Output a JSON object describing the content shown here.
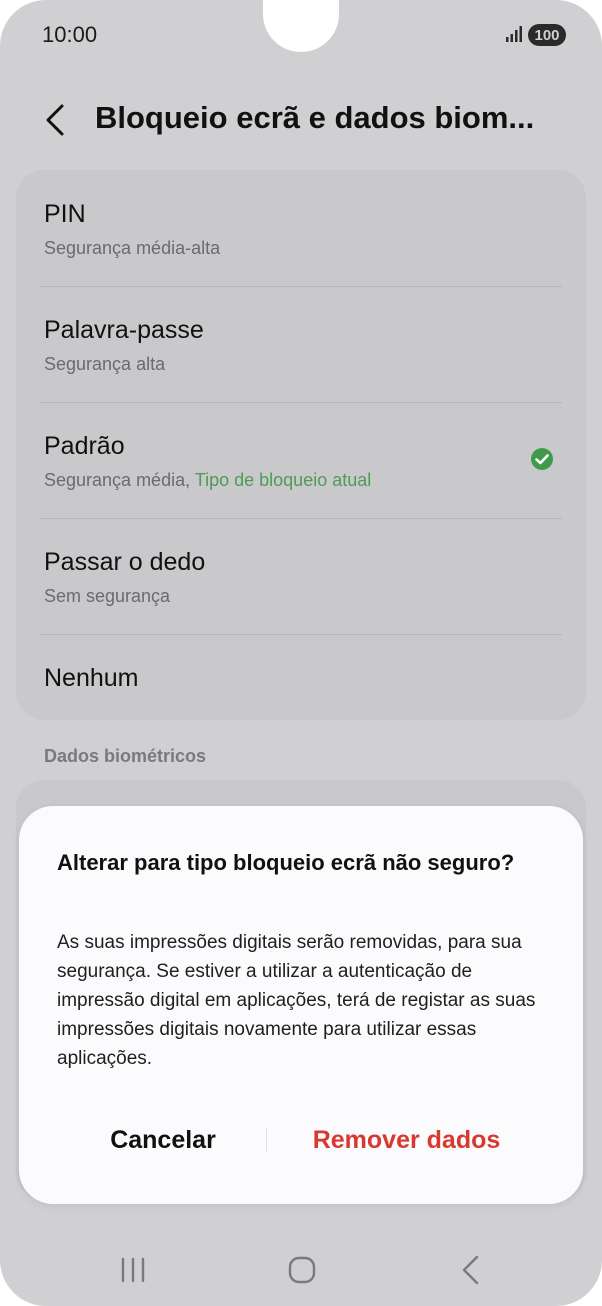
{
  "status_bar": {
    "time": "10:00",
    "battery": "100",
    "signal_icon": "signal-icon"
  },
  "header": {
    "back_icon": "chevron-left-icon",
    "title": "Bloqueio ecrã e dados biom..."
  },
  "lock_options": [
    {
      "label": "PIN",
      "sub": "Segurança média-alta"
    },
    {
      "label": "Palavra-passe",
      "sub": "Segurança alta"
    },
    {
      "label": "Padrão",
      "sub": "Segurança média,",
      "current": "Tipo de bloqueio atual",
      "selected": true
    },
    {
      "label": "Passar o dedo",
      "sub": "Sem segurança"
    },
    {
      "label": "Nenhum",
      "sub": ""
    }
  ],
  "section": {
    "biometrics_header": "Dados biométricos"
  },
  "dialog": {
    "title": "Alterar para tipo bloqueio ecrã não seguro?",
    "body": "As suas impressões digitais serão removidas, para sua segurança. Se estiver a utilizar a autenticação de impressão digital em aplicações, terá de registar as suas impressões digitais novamente para utilizar essas aplicações.",
    "cancel": "Cancelar",
    "confirm": "Remover dados"
  },
  "navbar": {
    "recent_icon": "recent-apps-icon",
    "home_icon": "home-icon",
    "back_icon": "back-icon"
  },
  "colors": {
    "accent_green": "#4f9a57",
    "destructive_red": "#d8392f",
    "dim_background": "#d0d0d2"
  }
}
